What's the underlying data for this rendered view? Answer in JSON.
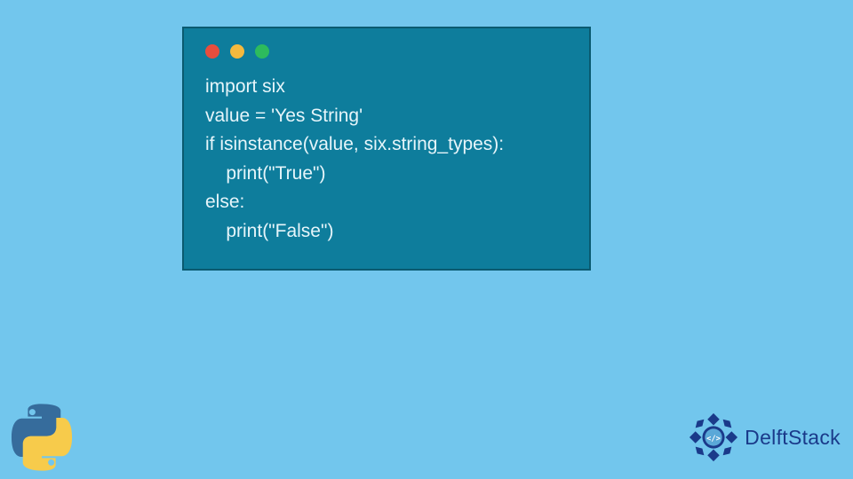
{
  "colors": {
    "background": "#72c6ed",
    "window_bg": "#0e7d9c",
    "window_border": "#0a5a70",
    "code_text": "#e6f5fa",
    "dot_red": "#e84d3d",
    "dot_yellow": "#f4b93e",
    "dot_green": "#2dbb5d",
    "python_blue": "#366c9c",
    "python_yellow": "#f7cb4b",
    "delft_blue": "#1a3a8a"
  },
  "code": {
    "lines": [
      "import six",
      "value = 'Yes String'",
      "if isinstance(value, six.string_types):",
      "    print(\"True\")",
      "else:",
      "    print(\"False\")"
    ],
    "full": "import six\nvalue = 'Yes String'\nif isinstance(value, six.string_types):\n    print(\"True\")\nelse:\n    print(\"False\")"
  },
  "logos": {
    "python": "python-logo",
    "delft_label": "DelftStack"
  }
}
